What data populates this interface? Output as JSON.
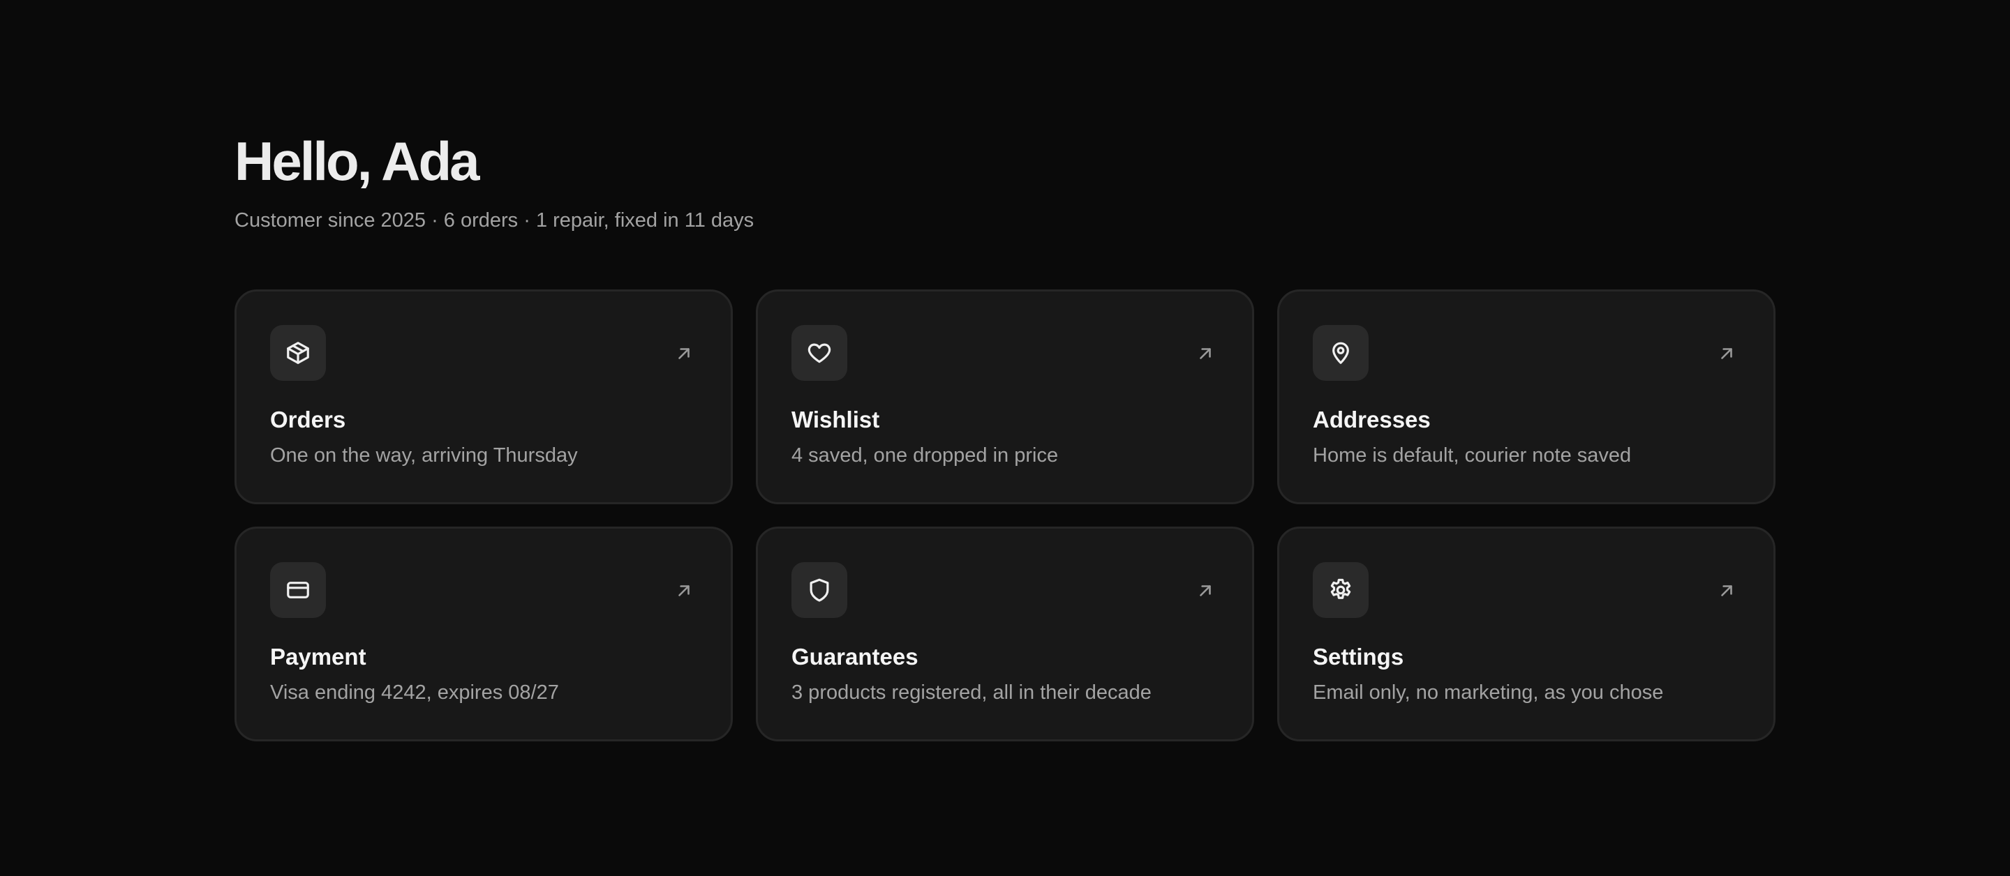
{
  "header": {
    "greeting": "Hello, Ada",
    "meta": "Customer since 2025 · 6 orders · 1 repair, fixed in 11 days"
  },
  "cards": [
    {
      "title": "Orders",
      "description": "One on the way, arriving Thursday",
      "icon": "package-icon"
    },
    {
      "title": "Wishlist",
      "description": "4 saved, one dropped in price",
      "icon": "heart-icon"
    },
    {
      "title": "Addresses",
      "description": "Home is default, courier note saved",
      "icon": "map-pin-icon"
    },
    {
      "title": "Payment",
      "description": "Visa ending 4242, expires 08/27",
      "icon": "credit-card-icon"
    },
    {
      "title": "Guarantees",
      "description": "3 products registered, all in their decade",
      "icon": "shield-icon"
    },
    {
      "title": "Settings",
      "description": "Email only, no marketing, as you chose",
      "icon": "gear-icon"
    }
  ],
  "colors": {
    "background": "#0a0a0a",
    "card": "#181818",
    "card_border": "#262626",
    "icon_box": "#2a2a2a",
    "text_primary": "#f5f5f5",
    "text_secondary": "#a3a3a3"
  }
}
